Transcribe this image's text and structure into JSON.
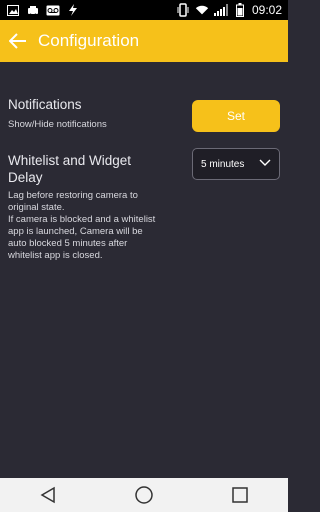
{
  "status_bar": {
    "time": "09:02",
    "icons": [
      "image-icon",
      "car-icon",
      "voicemail-icon",
      "lightning-icon",
      "vibrate-icon",
      "wifi-icon",
      "signal-icon",
      "battery-icon"
    ]
  },
  "appbar": {
    "title": "Configuration",
    "back_icon": "back-arrow-icon",
    "color": "#f6c11a"
  },
  "notifications": {
    "title": "Notifications",
    "subtitle": "Show/Hide notifications",
    "button_label": "Set"
  },
  "whitelist": {
    "title_line1": "Whitelist and Widget",
    "title_line2": "Delay",
    "desc_line1": "Lag before restoring camera to",
    "desc_line2": "original state.",
    "desc_line3": "If camera is blocked and a whitelist",
    "desc_line4": "app is launched, Camera will be",
    "desc_line5": "auto blocked 5 minutes after",
    "desc_line6": "whitelist app is closed.",
    "selected_option": "5 minutes",
    "dropdown_icon": "chevron-down-icon"
  },
  "navbar": {
    "icons": [
      "back-icon",
      "home-icon",
      "recent-apps-icon"
    ]
  }
}
